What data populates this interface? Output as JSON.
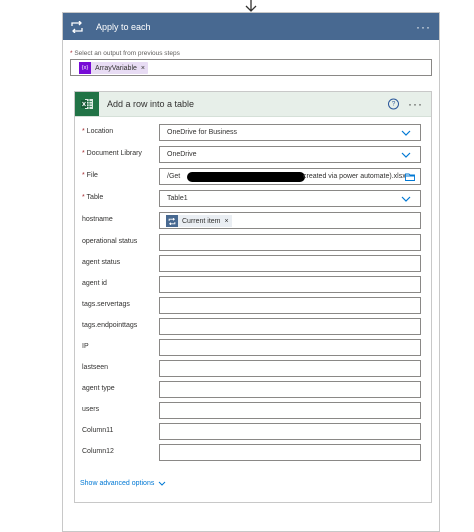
{
  "top_arrow": "arrow-down-icon",
  "apply_to_each": {
    "title": "Apply to each",
    "more": "···",
    "select_label_required": "*",
    "select_label": "Select an output from previous steps",
    "token": {
      "icon_text": "{x}",
      "label": "ArrayVariable",
      "remove": "×"
    }
  },
  "action": {
    "title": "Add a row into a table",
    "help": "?",
    "more": "···",
    "fields": {
      "location": {
        "label": "Location",
        "required": true,
        "value": "OneDrive for Business"
      },
      "library": {
        "label": "Document Library",
        "required": true,
        "value": "OneDrive"
      },
      "file": {
        "label": "File",
        "required": true,
        "value_prefix": "/Get",
        "value_suffix": "created via power automate).xlsx"
      },
      "table": {
        "label": "Table",
        "required": true,
        "value": "Table1"
      },
      "hostname": {
        "label": "hostname",
        "token_label": "Current item",
        "token_remove": "×"
      },
      "operational_status": {
        "label": "operational status",
        "value": ""
      },
      "agent_status": {
        "label": "agent status",
        "value": ""
      },
      "agent_id": {
        "label": "agent id",
        "value": ""
      },
      "servertags": {
        "label": "tags.servertags",
        "value": ""
      },
      "endpointtags": {
        "label": "tags.endpointtags",
        "value": ""
      },
      "ip": {
        "label": "IP",
        "value": ""
      },
      "lastseen": {
        "label": "lastseen",
        "value": ""
      },
      "agent_type": {
        "label": "agent type",
        "value": ""
      },
      "users": {
        "label": "users",
        "value": ""
      },
      "column11": {
        "label": "Column11",
        "value": ""
      },
      "column12": {
        "label": "Column12",
        "value": ""
      }
    },
    "show_advanced": "Show advanced options"
  },
  "colors": {
    "loop_header": "#486991",
    "excel_green": "#217346",
    "variable_purple": "#770bd6",
    "link_blue": "#0078d4",
    "required_red": "#a4262c"
  }
}
